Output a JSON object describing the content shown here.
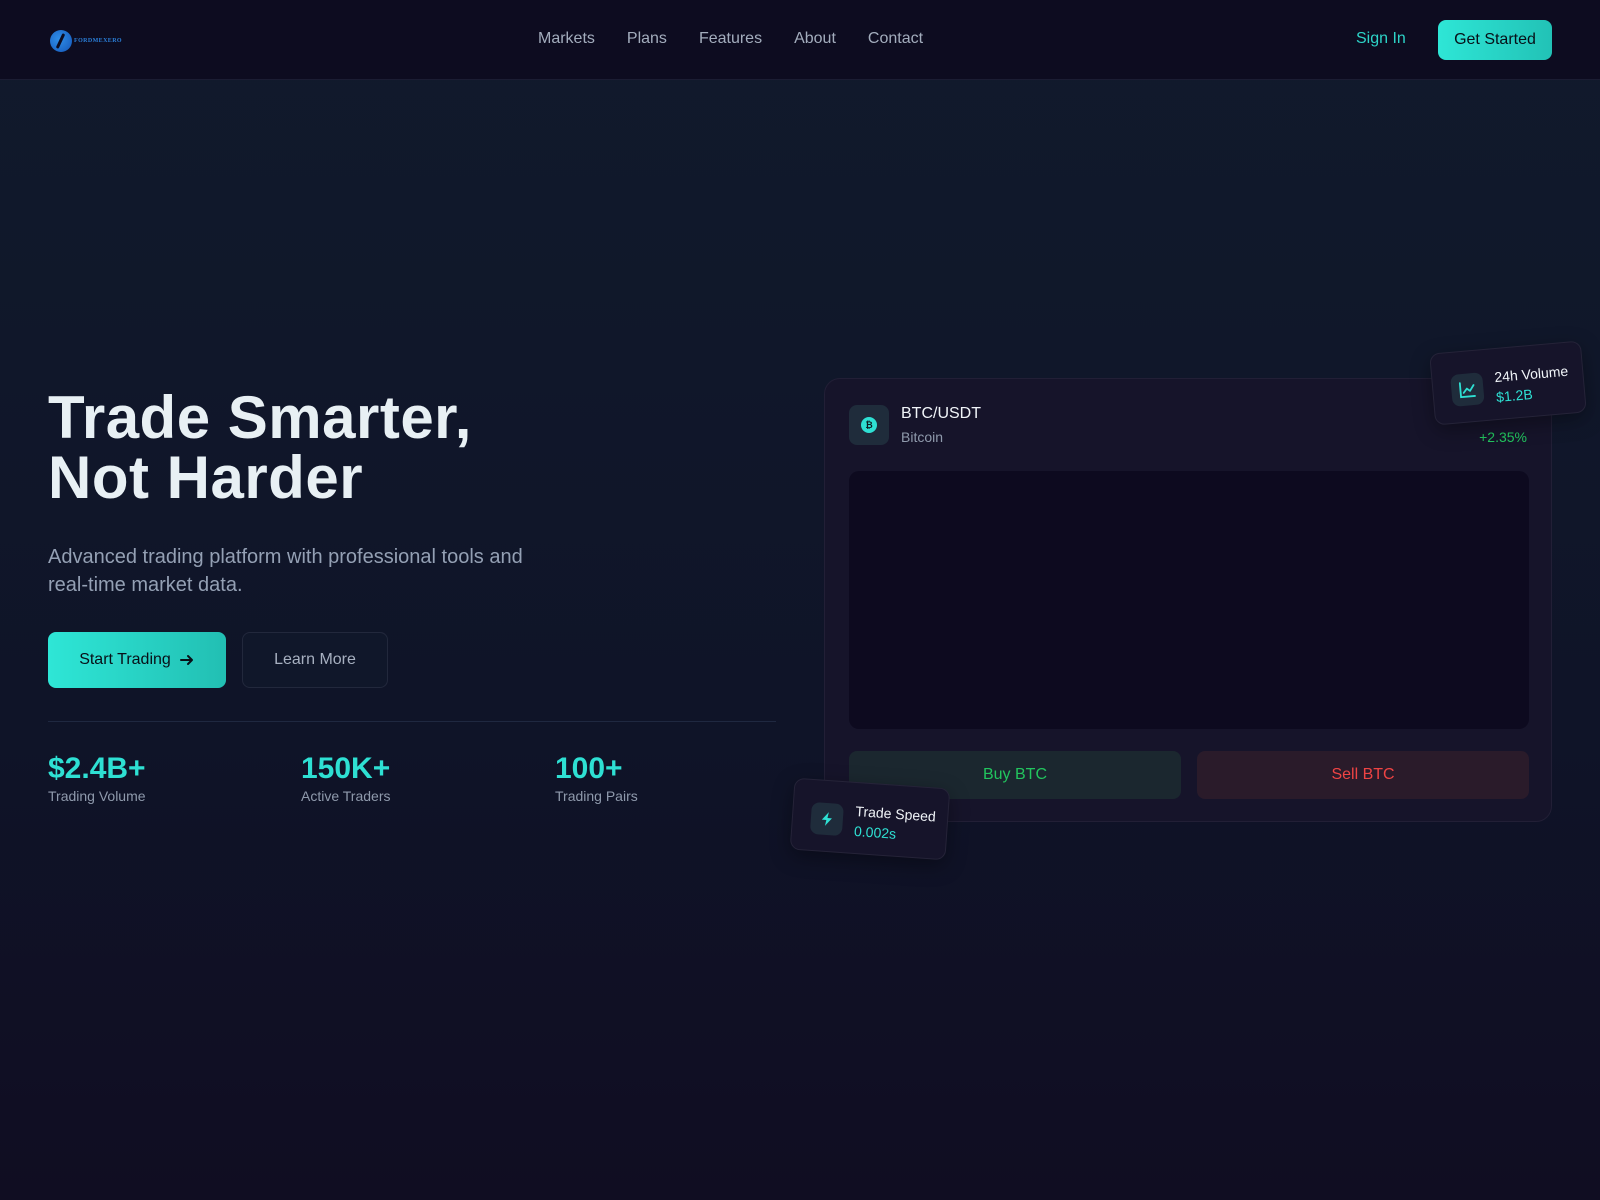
{
  "header": {
    "logo_text": "FORDMEXERO",
    "nav": [
      "Markets",
      "Plans",
      "Features",
      "About",
      "Contact"
    ],
    "signin_label": "Sign In",
    "get_started_label": "Get Started"
  },
  "hero": {
    "title_line1": "Trade Smarter,",
    "title_line2": "Not Harder",
    "subtitle": "Advanced trading platform with professional tools and real-time market data.",
    "start_label": "Start Trading",
    "learn_label": "Learn More",
    "stats": [
      {
        "value": "$2.4B+",
        "label": "Trading Volume"
      },
      {
        "value": "150K+",
        "label": "Active Traders"
      },
      {
        "value": "100+",
        "label": "Trading Pairs"
      }
    ]
  },
  "card": {
    "pair": "BTC/USDT",
    "name": "Bitcoin",
    "coin_symbol": "₿",
    "change": "+2.35%",
    "buy_label": "Buy BTC",
    "sell_label": "Sell BTC"
  },
  "badges": {
    "volume": {
      "title": "24h Volume",
      "value": "$1.2B"
    },
    "speed": {
      "title": "Trade Speed",
      "value": "0.002s"
    }
  },
  "colors": {
    "accent": "#2ee0d3",
    "buy": "#22c55e",
    "sell": "#ef4444"
  }
}
